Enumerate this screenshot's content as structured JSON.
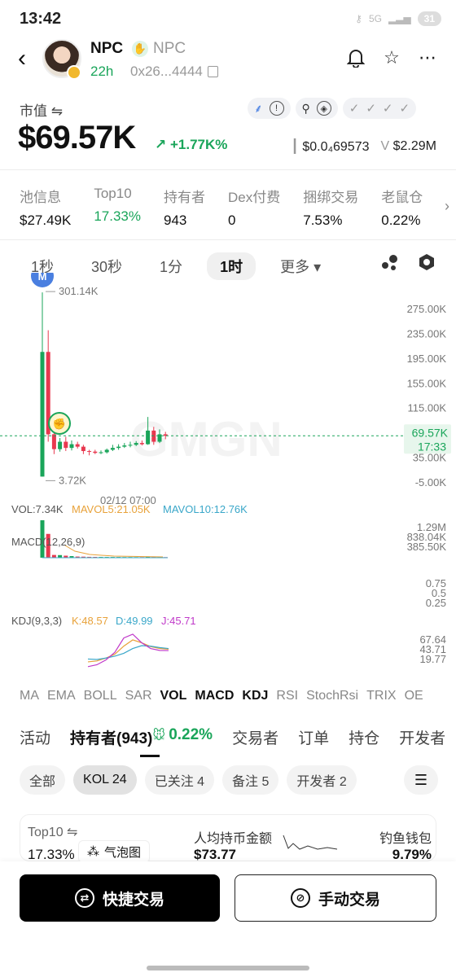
{
  "status": {
    "time": "13:42",
    "battery": "31",
    "signal": "5G"
  },
  "header": {
    "name": "NPC",
    "symbol": "NPC",
    "age": "22h",
    "address": "0x26...4444"
  },
  "market": {
    "label": "市值",
    "value": "$69.57K",
    "change": "+1.77K%",
    "price": "$0.0₄69573",
    "volume_label": "V",
    "volume": "$2.29M"
  },
  "pool_info": [
    {
      "label": "池信息",
      "value": "$27.49K",
      "color": "#111111"
    },
    {
      "label": "Top10",
      "value": "17.33%",
      "color": "#1aa55a"
    },
    {
      "label": "持有者",
      "value": "943",
      "color": "#111111"
    },
    {
      "label": "Dex付费",
      "value": "0",
      "color": "#111111"
    },
    {
      "label": "捆绑交易",
      "value": "7.53%",
      "color": "#111111"
    },
    {
      "label": "老鼠仓",
      "value": "0.22%",
      "color": "#111111"
    }
  ],
  "intervals": [
    "1秒",
    "30秒",
    "1分",
    "1时",
    "更多"
  ],
  "chart_data": {
    "type": "candlestick",
    "price_axis": [
      "275.00K",
      "235.00K",
      "195.00K",
      "155.00K",
      "115.00K",
      "75.00K",
      "35.00K",
      "-5.00K"
    ],
    "high_label": "301.14K",
    "low_label": "3.72K",
    "current": "69.57K",
    "countdown": "17:33",
    "time_label": "02/12 07:00",
    "watermark": "GMGN",
    "candles": [
      {
        "o": 3.72,
        "c": 205,
        "h": 301.14,
        "l": 3.72
      },
      {
        "o": 205,
        "c": 72,
        "h": 240,
        "l": 60
      },
      {
        "o": 72,
        "c": 48,
        "h": 80,
        "l": 40
      },
      {
        "o": 48,
        "c": 60,
        "h": 66,
        "l": 44
      },
      {
        "o": 60,
        "c": 50,
        "h": 68,
        "l": 45
      },
      {
        "o": 50,
        "c": 56,
        "h": 62,
        "l": 46
      },
      {
        "o": 56,
        "c": 52,
        "h": 60,
        "l": 49
      },
      {
        "o": 52,
        "c": 45,
        "h": 55,
        "l": 40
      },
      {
        "o": 45,
        "c": 44,
        "h": 47,
        "l": 38
      },
      {
        "o": 44,
        "c": 42,
        "h": 47,
        "l": 40
      },
      {
        "o": 42,
        "c": 43,
        "h": 46,
        "l": 40
      },
      {
        "o": 43,
        "c": 47,
        "h": 49,
        "l": 41
      },
      {
        "o": 47,
        "c": 50,
        "h": 55,
        "l": 45
      },
      {
        "o": 50,
        "c": 52,
        "h": 56,
        "l": 47
      },
      {
        "o": 52,
        "c": 54,
        "h": 58,
        "l": 50
      },
      {
        "o": 54,
        "c": 55,
        "h": 60,
        "l": 51
      },
      {
        "o": 55,
        "c": 58,
        "h": 61,
        "l": 53
      },
      {
        "o": 58,
        "c": 56,
        "h": 62,
        "l": 54
      },
      {
        "o": 56,
        "c": 78,
        "h": 100,
        "l": 55
      },
      {
        "o": 78,
        "c": 60,
        "h": 84,
        "l": 55
      },
      {
        "o": 60,
        "c": 72,
        "h": 80,
        "l": 58
      },
      {
        "o": 72,
        "c": 69.57,
        "h": 76,
        "l": 64
      }
    ],
    "volume_axis": [
      "1.29M",
      "838.04K",
      "385.50K"
    ],
    "vol_series": [
      1290,
      820,
      95,
      90,
      70,
      55,
      40,
      36,
      30,
      28,
      26,
      25,
      25,
      24,
      22,
      22,
      20,
      20,
      30,
      24,
      22,
      20
    ],
    "macd_axis": [
      "0.75",
      "0.5",
      "0.25"
    ],
    "kdj_axis": [
      "67.64",
      "43.71",
      "19.77"
    ],
    "kdj_k": [
      22,
      24,
      30,
      38,
      55,
      68,
      62,
      54,
      50,
      48.57
    ],
    "kdj_d": [
      28,
      27,
      30,
      34,
      40,
      50,
      56,
      55,
      52,
      49.99
    ],
    "kdj_j": [
      12,
      16,
      26,
      42,
      72,
      80,
      62,
      50,
      46,
      45.71
    ]
  },
  "indicators": {
    "vol": "VOL:7.34K",
    "mavol5": "MAVOL5:21.05K",
    "mavol10": "MAVOL10:12.76K",
    "macd": "MACD(12,26,9)",
    "kdj": "KDJ(9,3,3)",
    "k": "K:48.57",
    "d": "D:49.99",
    "j": "J:45.71",
    "tabs": [
      "MA",
      "EMA",
      "BOLL",
      "SAR",
      "VOL",
      "MACD",
      "KDJ",
      "RSI",
      "StochRsi",
      "TRIX",
      "OE"
    ]
  },
  "holder_tabs": [
    "活动",
    "持有者(943)",
    "0.22%",
    "交易者",
    "订单",
    "持仓",
    "开发者"
  ],
  "filters": [
    "全部",
    "KOL 24",
    "已关注 4",
    "备注 5",
    "开发者 2"
  ],
  "card": {
    "top10_label": "Top10",
    "top10_value": "17.33%",
    "bubble": "气泡图",
    "avg_label": "人均持币金额",
    "avg_value": "$73.77",
    "fish_label": "钓鱼钱包",
    "fish_value": "9.79%"
  },
  "buttons": {
    "quick": "快捷交易",
    "manual": "手动交易"
  },
  "colors": {
    "up": "#1aa55a",
    "down": "#e8384f",
    "accent": "#1aa55a"
  }
}
